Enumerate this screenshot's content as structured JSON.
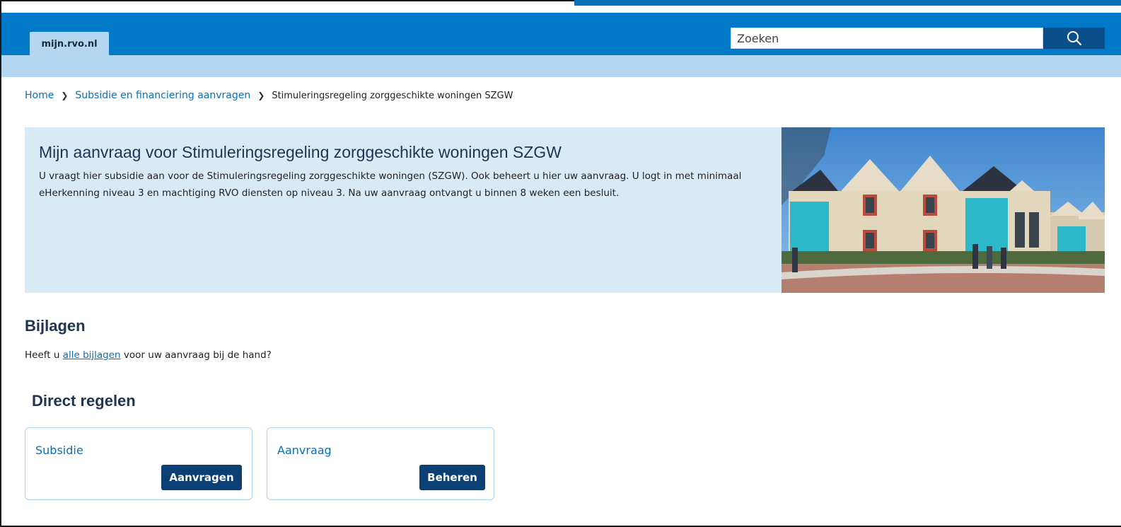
{
  "header": {
    "site_tab": "mijn.rvo.nl",
    "search_placeholder": "Zoeken",
    "search_icon": "search-icon",
    "brand_color": "#0178c8",
    "sub_bar_color": "#b3d7f0"
  },
  "breadcrumb": {
    "items": [
      "Home",
      "Subsidie en financiering aanvragen"
    ],
    "current": "Stimuleringsregeling zorggeschikte woningen SZGW",
    "separator_icon": "chevron-right-icon"
  },
  "hero": {
    "title": "Mijn aanvraag voor Stimuleringsregeling zorggeschikte woningen SZGW",
    "description": "U vraagt hier subsidie aan voor de Stimuleringsregeling zorggeschikte woningen (SZGW). Ook beheert u hier uw aanvraag. U logt in met minimaal eHerkenning niveau 3 en machtiging RVO diensten op niveau 3. Na uw aanvraag ontvangt u binnen 8 weken een besluit.",
    "background_color": "#d9eaf7"
  },
  "bijlagen": {
    "title": "Bijlagen",
    "text_before": "Heeft u ",
    "link": "alle bijlagen",
    "text_after": " voor uw aanvraag bij de hand?"
  },
  "direct_regelen": {
    "title": "Direct regelen",
    "cards": [
      {
        "title": "Subsidie",
        "button": "Aanvragen"
      },
      {
        "title": "Aanvraag",
        "button": "Beheren"
      }
    ],
    "button_color": "#0c3f73"
  }
}
